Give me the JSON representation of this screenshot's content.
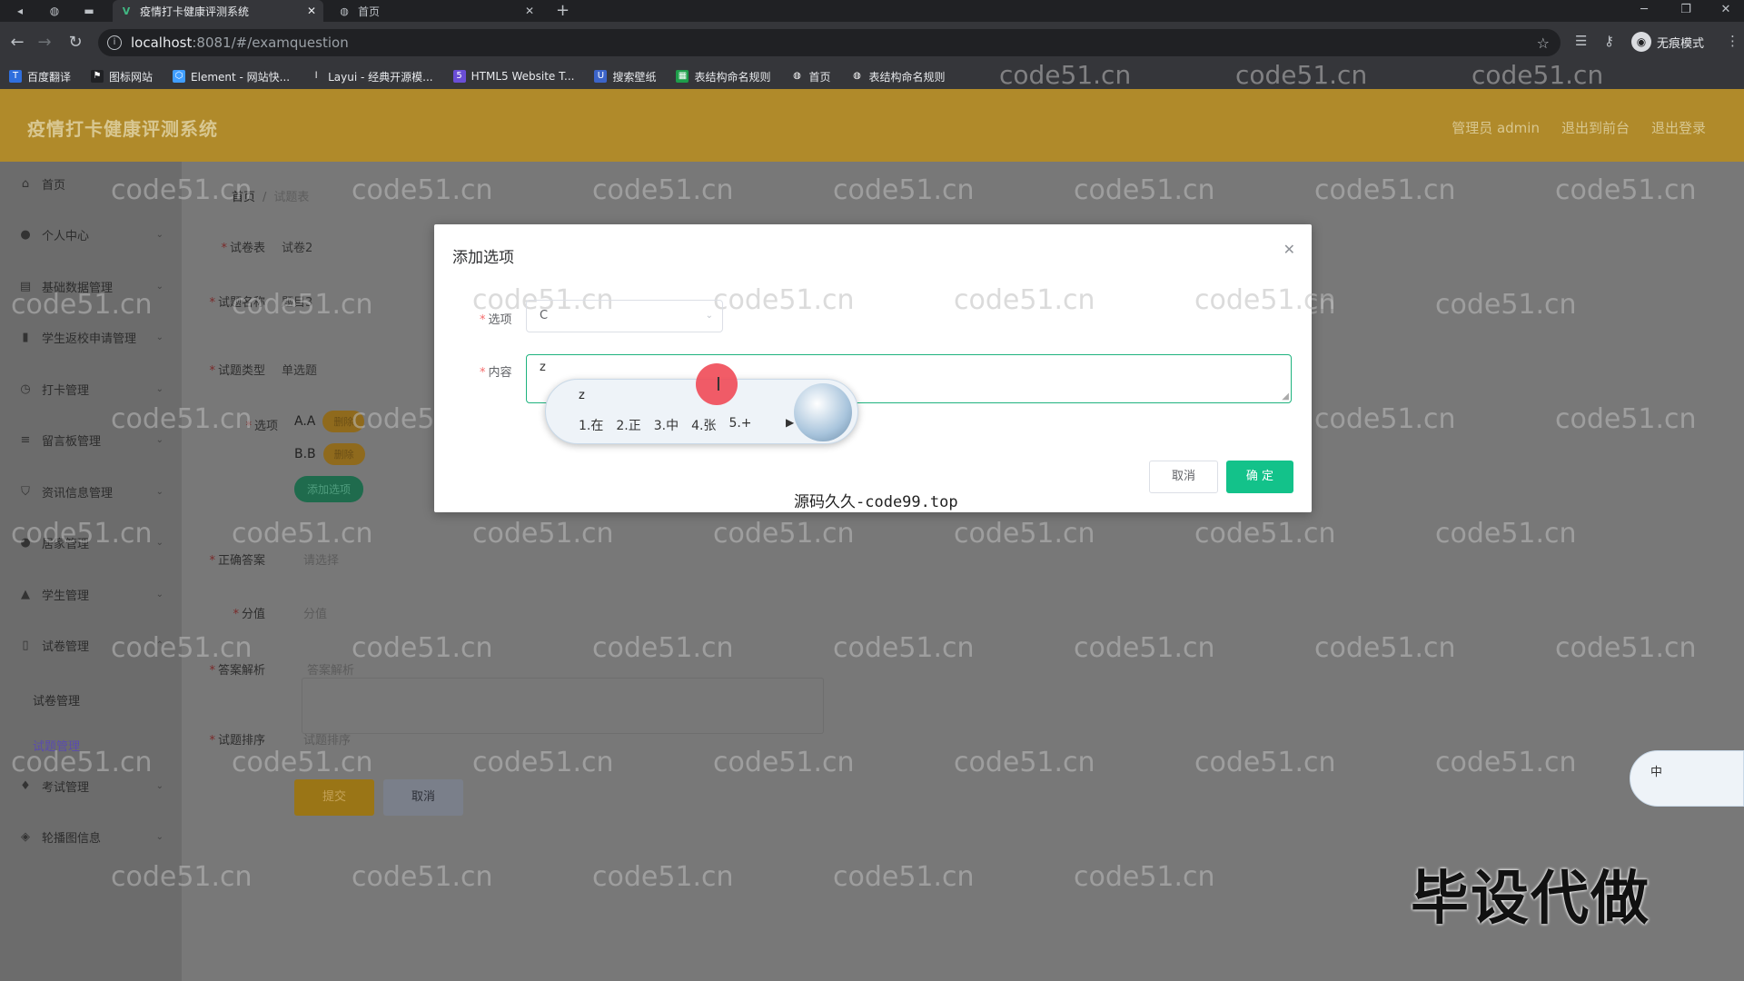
{
  "browser": {
    "tabs": [
      {
        "label": "疫情打卡健康评测系统",
        "active": true
      },
      {
        "label": "首页",
        "active": false
      }
    ],
    "url_host": "localhost",
    "url_path": ":8081/#/examquestion",
    "incognito_label": "无痕模式",
    "bookmarks": [
      "百度翻译",
      "图标网站",
      "Element - 网站快...",
      "Layui - 经典开源模...",
      "HTML5 Website T...",
      "搜索壁纸",
      "表结构命名规则",
      "首页",
      "表结构命名规则"
    ]
  },
  "header": {
    "title": "疫情打卡健康评测系统",
    "admin_label": "管理员 admin",
    "back_label": "退出到前台",
    "logout_label": "退出登录"
  },
  "sidebar": {
    "items": [
      "首页",
      "个人中心",
      "基础数据管理",
      "学生返校申请管理",
      "打卡管理",
      "留言板管理",
      "资讯信息管理",
      "居家管理",
      "学生管理",
      "试卷管理",
      "考试管理",
      "轮播图信息"
    ],
    "sub_items": [
      "试卷管理",
      "试题管理"
    ]
  },
  "breadcrumb": {
    "home": "首页",
    "current": "试题表"
  },
  "form": {
    "paper_label": "试卷表",
    "paper_value": "试卷2",
    "name_label": "试题名称",
    "name_value": "题目3",
    "type_label": "试题类型",
    "type_value": "单选题",
    "options_label": "选项",
    "options": [
      {
        "text": "A.A",
        "del": "删除"
      },
      {
        "text": "B.B",
        "del": "删除"
      }
    ],
    "add_option": "添加选项",
    "answer_label": "正确答案",
    "answer_placeholder": "请选择",
    "score_label": "分值",
    "score_placeholder": "分值",
    "analysis_label": "答案解析",
    "analysis_placeholder": "答案解析",
    "sort_label": "试题排序",
    "sort_placeholder": "试题排序",
    "submit": "提交",
    "cancel": "取消"
  },
  "dialog": {
    "title": "添加选项",
    "option_label": "选项",
    "option_value": "C",
    "content_label": "内容",
    "content_value": "z",
    "ime_composition": "z",
    "ime_candidates": [
      "1.在",
      "2.正",
      "3.中",
      "4.张",
      "5.+"
    ],
    "cancel": "取消",
    "confirm": "确 定",
    "watermark": "源码久久-code99.top"
  },
  "watermark_text": "code51.cn",
  "overlay_text": "毕设代做",
  "ime_float_label": "中"
}
